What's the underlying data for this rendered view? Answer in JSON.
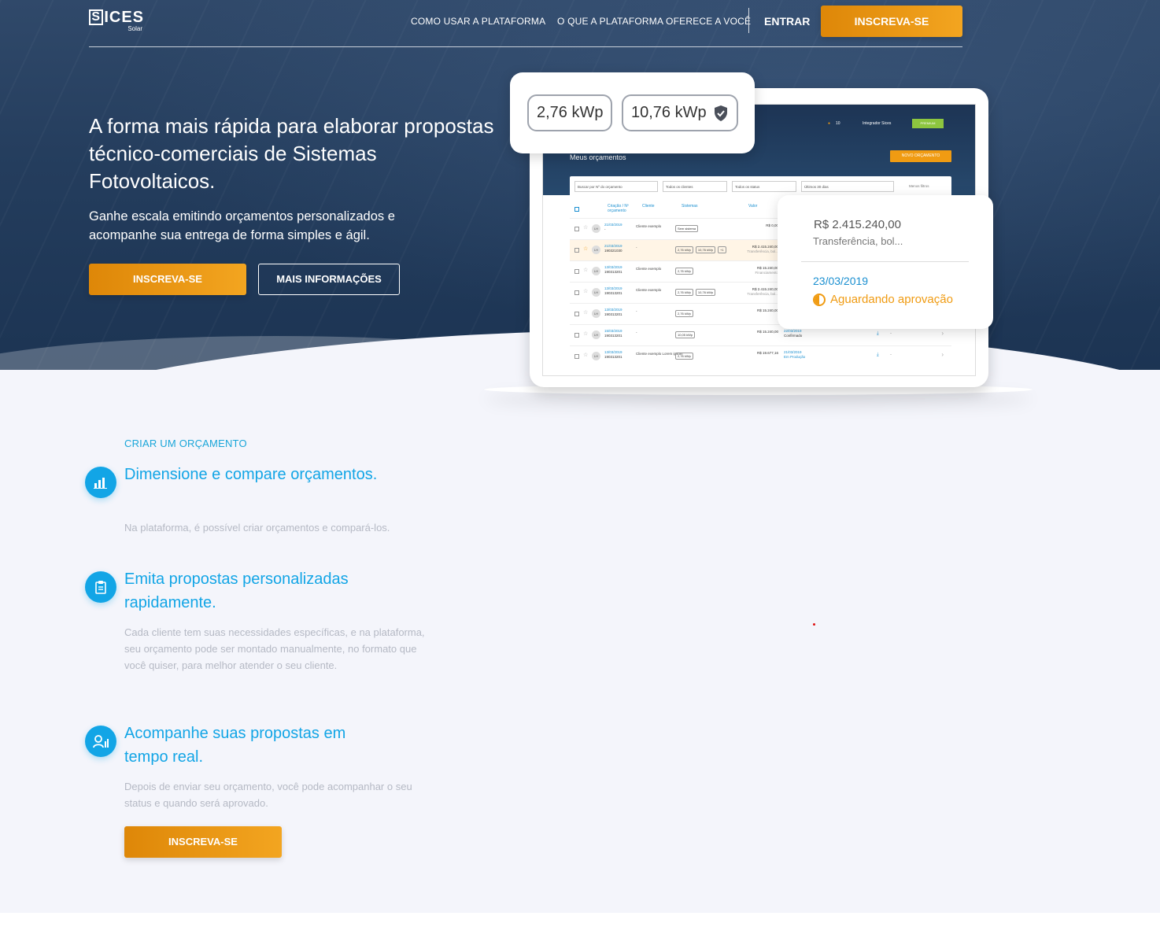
{
  "nav": {
    "logo_main": "ICES",
    "logo_letter": "S",
    "logo_sub": "Solar",
    "links": [
      "COMO USAR A PLATAFORMA",
      "O QUE A PLATAFORMA OFERECE A VOCÊ"
    ],
    "login": "ENTRAR",
    "signup": "INSCREVA-SE"
  },
  "hero": {
    "title": "A forma mais rápida para elaborar propostas técnico-comerciais de Sistemas Fotovoltaicos.",
    "subtitle": "Ganhe escala emitindo orçamentos personalizados e acompanhe sua entrega de forma simples e ágil.",
    "cta_primary": "INSCREVA-SE",
    "cta_secondary": "MAIS INFORMAÇÕES"
  },
  "mockup": {
    "kwp_cards": [
      "2,76 kWp",
      "10,76 kWp"
    ],
    "screen": {
      "title": "Meus orçamentos",
      "new_button": "NOVO ORÇAMENTO",
      "notif_count": "10",
      "user": "Integrador Sices",
      "badge": "PREMIUM",
      "filters": [
        "Buscar por Nº do orçamento",
        "Todos os clientes",
        "Todos os status",
        "Últimos 30 dias",
        "Menos filtros"
      ],
      "headers": [
        "Criação / Nº orçamento",
        "Cliente",
        "Sistemas",
        "Valor"
      ],
      "rows": [
        {
          "date": "21/03/2019",
          "num": "-",
          "client": "Cliente exemplo",
          "tags": [
            "Sem sistema"
          ],
          "value": "R$ 0,00",
          "pay": "",
          "status": "",
          "status2": ""
        },
        {
          "date": "21/03/2019",
          "num": "190321030",
          "client": "-",
          "tags": [
            "2,76 kWp",
            "10,76 kWp",
            "+1"
          ],
          "value": "R$ 2.415.240,00",
          "pay": "Transferência, bol...",
          "status": "",
          "status2": ""
        },
        {
          "date": "13/03/2019",
          "num": "190313201",
          "client": "Cliente exemplo",
          "tags": [
            "2,76 kWp"
          ],
          "value": "R$ 15.240,00",
          "pay": "Financiamento",
          "status": "",
          "status2": ""
        },
        {
          "date": "13/03/2019",
          "num": "190313201",
          "client": "Cliente exemplo",
          "tags": [
            "2,76 kWp",
            "10,76 kWp"
          ],
          "value": "R$ 2.415.240,00",
          "pay": "Transferência, bol...",
          "status": "",
          "status2": ""
        },
        {
          "date": "13/03/2019",
          "num": "190313201",
          "client": "-",
          "tags": [
            "2,76 kWp"
          ],
          "value": "R$ 15.240,00",
          "pay": "",
          "status": "",
          "status2": ""
        },
        {
          "date": "15/03/2019",
          "num": "190313201",
          "client": "-",
          "tags": [
            "10,05 kWp"
          ],
          "value": "R$ 15.240,00",
          "pay": "",
          "status": "22/03/2019",
          "status2": "Confirmado"
        },
        {
          "date": "13/03/2019",
          "num": "190313201",
          "client": "Cliente exemplo Lorem ipsum",
          "tags": [
            "2,76 kWp"
          ],
          "value": "R$ 19.677,16",
          "pay": "",
          "status": "21/03/2019",
          "status2": "Em Produção"
        }
      ]
    },
    "value_card": {
      "amount": "R$ 2.415.240,00",
      "method": "Transferência, bol...",
      "date": "23/03/2019",
      "status": "Aguardando aprovação"
    }
  },
  "features": {
    "eyebrow": "CRIAR UM ORÇAMENTO",
    "items": [
      {
        "icon": "bar-chart-icon",
        "title": "Dimensione e compare orçamentos.",
        "desc": "Na plataforma, é possível criar orçamentos e compará-los."
      },
      {
        "icon": "clipboard-icon",
        "title": "Emita propostas personalizadas rapidamente.",
        "desc": "Cada cliente tem suas necessidades específicas, e na plataforma, seu orçamento pode ser montado manualmente, no formato que você quiser, para melhor atender o seu cliente."
      },
      {
        "icon": "user-chart-icon",
        "title": "Acompanhe suas propostas em tempo real.",
        "desc": "Depois de enviar seu orçamento, você pode acompanhar o seu status e quando será aprovado."
      }
    ],
    "cta": "INSCREVA-SE"
  },
  "colors": {
    "accent": "#12a5e6",
    "orange": "#f09b12",
    "hero_bg": "#243d5d"
  }
}
